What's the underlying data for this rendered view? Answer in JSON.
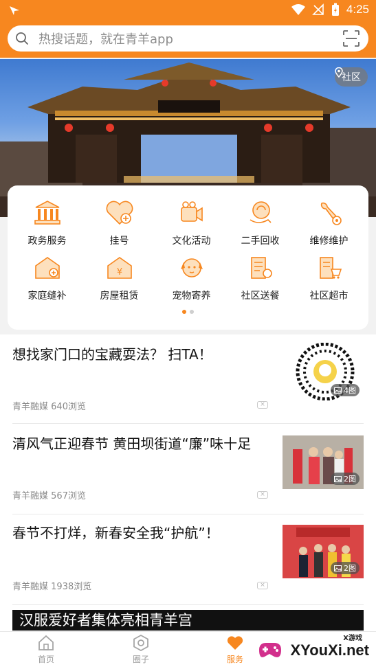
{
  "status_bar": {
    "time": "4:25"
  },
  "search": {
    "placeholder": "热搜话题，就在青羊app"
  },
  "banner": {
    "location_label": "社区"
  },
  "services": {
    "items": [
      {
        "label": "政务服务",
        "icon": "government-building-icon"
      },
      {
        "label": "挂号",
        "icon": "heart-plus-icon"
      },
      {
        "label": "文化活动",
        "icon": "video-camera-icon"
      },
      {
        "label": "二手回收",
        "icon": "recycle-icon"
      },
      {
        "label": "维修维护",
        "icon": "wrench-icon"
      },
      {
        "label": "家庭缝补",
        "icon": "sewing-house-icon"
      },
      {
        "label": "房屋租赁",
        "icon": "house-rent-icon"
      },
      {
        "label": "宠物寄养",
        "icon": "pet-dog-icon"
      },
      {
        "label": "社区送餐",
        "icon": "meal-delivery-icon"
      },
      {
        "label": "社区超市",
        "icon": "supermarket-cart-icon"
      }
    ],
    "page_count": 2,
    "current_page": 1
  },
  "feed": {
    "items": [
      {
        "title": "想找家门口的宝藏耍法？  扫TA！",
        "source": "青羊融媒",
        "views": "640浏览",
        "image_count": "4图"
      },
      {
        "title": "清风气正迎春节  黄田坝街道“廉”味十足",
        "source": "青羊融媒",
        "views": "567浏览",
        "image_count": "2图"
      },
      {
        "title": "春节不打烊，新春安全我“护航”！",
        "source": "青羊融媒",
        "views": "1938浏览",
        "image_count": "2图"
      }
    ],
    "partial_item_title": "汉服爱好者集体亮相青羊宫"
  },
  "bottom_nav": {
    "tabs": [
      {
        "label": "首页",
        "icon": "home-icon",
        "active": false
      },
      {
        "label": "圈子",
        "icon": "circle-hexagon-icon",
        "active": false
      },
      {
        "label": "服务",
        "icon": "heart-icon",
        "active": true
      }
    ]
  },
  "watermark": {
    "small": "X游戏",
    "big": "XYouXi.net"
  },
  "colors": {
    "accent": "#f7871f",
    "text": "#111111",
    "meta": "#8a8a8a"
  }
}
